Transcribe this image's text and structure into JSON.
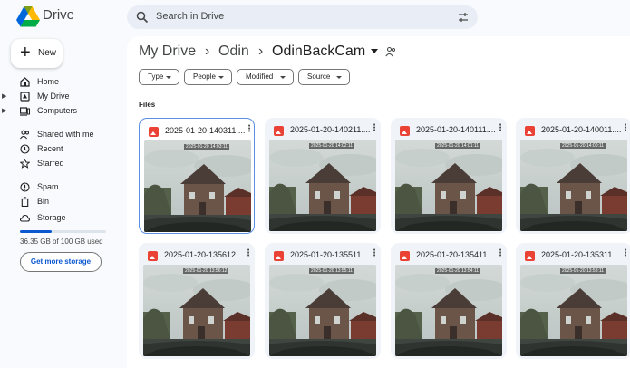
{
  "app": {
    "title": "Drive"
  },
  "search": {
    "placeholder": "Search in Drive"
  },
  "sidebar": {
    "new_label": "New",
    "items": [
      {
        "label": "Home",
        "icon": "home-icon",
        "expandable": false
      },
      {
        "label": "My Drive",
        "icon": "my-drive-icon",
        "expandable": true
      },
      {
        "label": "Computers",
        "icon": "computers-icon",
        "expandable": true
      },
      {
        "label": "Shared with me",
        "icon": "shared-icon",
        "expandable": false
      },
      {
        "label": "Recent",
        "icon": "clock-icon",
        "expandable": false
      },
      {
        "label": "Starred",
        "icon": "star-icon",
        "expandable": false
      },
      {
        "label": "Spam",
        "icon": "spam-icon",
        "expandable": false
      },
      {
        "label": "Bin",
        "icon": "bin-icon",
        "expandable": false
      },
      {
        "label": "Storage",
        "icon": "cloud-icon",
        "expandable": false
      }
    ],
    "storage_used_fraction": 0.3635,
    "storage_text": "36.35 GB of 100 GB used",
    "get_storage_label": "Get more storage"
  },
  "breadcrumb": {
    "items": [
      "My Drive",
      "Odin",
      "OdinBackCam"
    ],
    "separator": "›"
  },
  "filters": [
    {
      "label": "Type"
    },
    {
      "label": "People"
    },
    {
      "label": "Modified"
    },
    {
      "label": "Source"
    }
  ],
  "files_heading": "Files",
  "files": [
    {
      "name": "2025-01-20-140311....",
      "stamp": "2025-01-20 14:03:11",
      "selected": true
    },
    {
      "name": "2025-01-20-140211....",
      "stamp": "2025-01-20 14:02:11",
      "selected": false
    },
    {
      "name": "2025-01-20-140111....",
      "stamp": "2025-01-20 14:01:11",
      "selected": false
    },
    {
      "name": "2025-01-20-140011....",
      "stamp": "2025-01-20 14:00:11",
      "selected": false
    },
    {
      "name": "2025-01-20-135612....",
      "stamp": "2025-01-20 13:56:12",
      "selected": false
    },
    {
      "name": "2025-01-20-135511....",
      "stamp": "2025-01-20 13:55:11",
      "selected": false
    },
    {
      "name": "2025-01-20-135411....",
      "stamp": "2025-01-20 13:54:11",
      "selected": false
    },
    {
      "name": "2025-01-20-135311....",
      "stamp": "2025-01-20 13:53:11",
      "selected": false
    }
  ],
  "colors": {
    "accent": "#0b57d0",
    "file_icon": "#ea4335",
    "selected_border": "#5b8fe0"
  }
}
